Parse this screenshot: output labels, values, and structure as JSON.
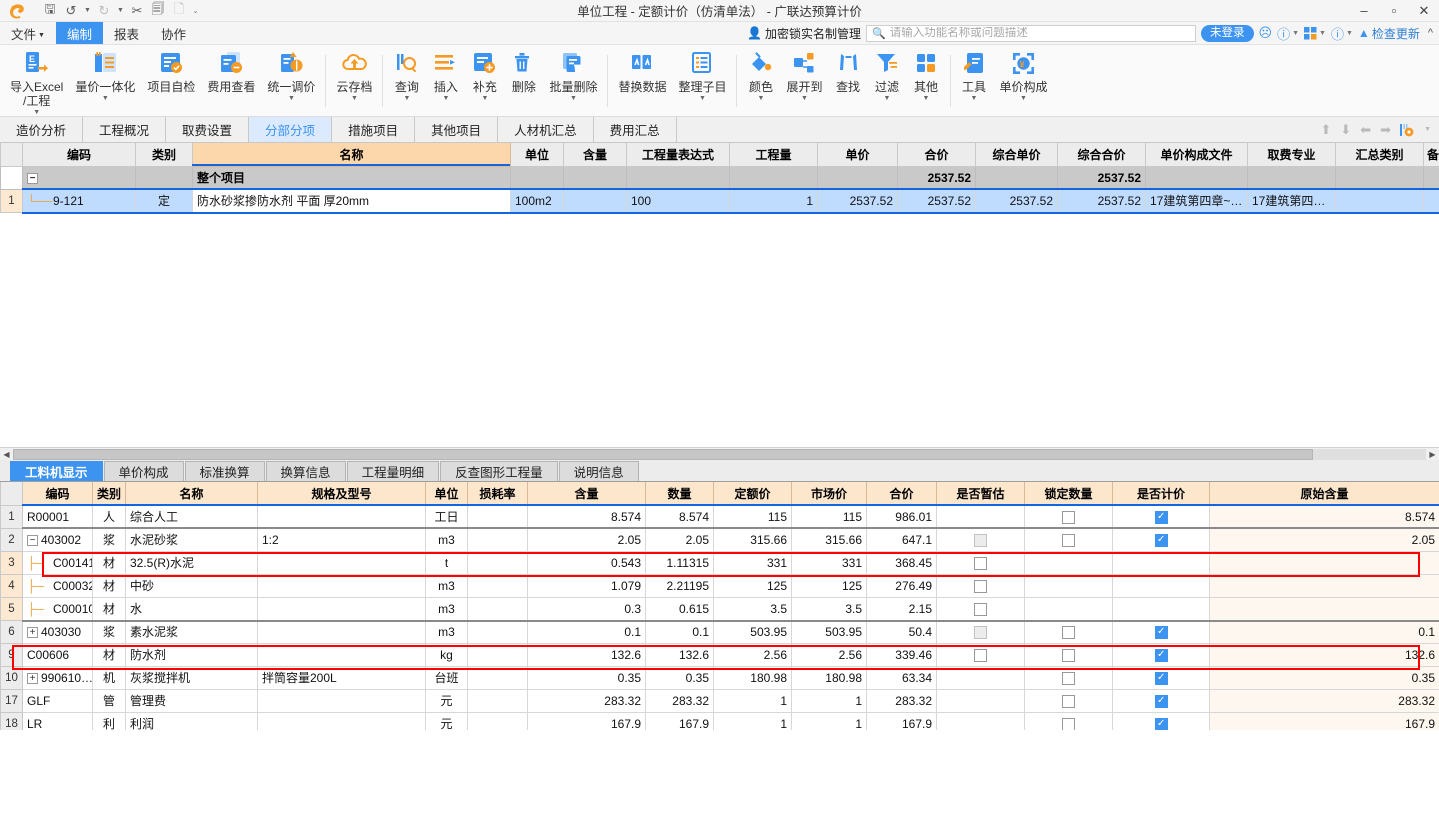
{
  "window": {
    "title": "单位工程 - 定额计价（仿清单法） - 广联达预算计价",
    "minimize": "–",
    "maximize": "▫",
    "close": "✕"
  },
  "quick_access": [
    {
      "name": "save-icon",
      "glyph": "🖫"
    },
    {
      "name": "undo-icon",
      "glyph": "↺"
    },
    {
      "name": "redo-icon",
      "glyph": "↻"
    },
    {
      "name": "cut-icon",
      "glyph": "✂"
    },
    {
      "name": "copy-icon",
      "glyph": "🗐"
    },
    {
      "name": "paste-icon",
      "glyph": "🗋"
    }
  ],
  "menu": {
    "items": [
      {
        "label": "文件",
        "caret": true,
        "active": false
      },
      {
        "label": "编制",
        "caret": false,
        "active": true
      },
      {
        "label": "报表",
        "caret": false,
        "active": false
      },
      {
        "label": "协作",
        "caret": false,
        "active": false
      }
    ],
    "lock_manager": "加密锁实名制管理",
    "login_status": "未登录",
    "check_update": "检查更新"
  },
  "search": {
    "placeholder": "请输入功能名称或问题描述",
    "value": ""
  },
  "ribbon": {
    "buttons": [
      {
        "label": "导入Excel\n/工程",
        "icon": "excel-import-icon",
        "caret": true
      },
      {
        "label": "量价一体化",
        "icon": "quantity-price-icon",
        "caret": true
      },
      {
        "label": "项目自检",
        "icon": "self-check-icon",
        "caret": false
      },
      {
        "label": "费用查看",
        "icon": "fee-view-icon",
        "caret": false
      },
      {
        "label": "统一调价",
        "icon": "unified-price-icon",
        "caret": true
      },
      {
        "label": "云存档",
        "icon": "cloud-archive-icon",
        "caret": true
      },
      {
        "label": "查询",
        "icon": "query-icon",
        "caret": true
      },
      {
        "label": "插入",
        "icon": "insert-icon",
        "caret": true
      },
      {
        "label": "补充",
        "icon": "supplement-icon",
        "caret": true
      },
      {
        "label": "删除",
        "icon": "delete-icon",
        "caret": false
      },
      {
        "label": "批量删除",
        "icon": "batch-delete-icon",
        "caret": true
      },
      {
        "label": "替换数据",
        "icon": "replace-data-icon",
        "caret": false
      },
      {
        "label": "整理子目",
        "icon": "organize-item-icon",
        "caret": true
      },
      {
        "label": "颜色",
        "icon": "color-icon",
        "caret": true
      },
      {
        "label": "展开到",
        "icon": "expand-to-icon",
        "caret": true
      },
      {
        "label": "查找",
        "icon": "find-icon",
        "caret": false
      },
      {
        "label": "过滤",
        "icon": "filter-icon",
        "caret": true
      },
      {
        "label": "其他",
        "icon": "other-icon",
        "caret": true
      },
      {
        "label": "工具",
        "icon": "tools-icon",
        "caret": true
      },
      {
        "label": "单价构成",
        "icon": "unit-price-composition-icon",
        "caret": true
      }
    ]
  },
  "tabs": {
    "items": [
      {
        "label": "造价分析",
        "active": false
      },
      {
        "label": "工程概况",
        "active": false
      },
      {
        "label": "取费设置",
        "active": false
      },
      {
        "label": "分部分项",
        "active": true
      },
      {
        "label": "措施项目",
        "active": false
      },
      {
        "label": "其他项目",
        "active": false
      },
      {
        "label": "人材机汇总",
        "active": false
      },
      {
        "label": "费用汇总",
        "active": false
      }
    ],
    "nav_icons": [
      "arrow-up-icon",
      "arrow-down-icon",
      "arrow-left-icon",
      "arrow-right-icon",
      "column-settings-icon"
    ]
  },
  "main_table": {
    "columns": [
      "",
      "编码",
      "类别",
      "名称",
      "单位",
      "含量",
      "工程量表达式",
      "工程量",
      "单价",
      "合价",
      "综合单价",
      "综合合价",
      "单价构成文件",
      "取费专业",
      "汇总类别",
      "备"
    ],
    "rows": [
      {
        "type": "group",
        "row_number": "",
        "expander": "−",
        "cells": {
          "编码": "",
          "类别": "",
          "名称": "整个项目",
          "单位": "",
          "含量": "",
          "工程量表达式": "",
          "工程量": "",
          "单价": "",
          "合价": "2537.52",
          "综合单价": "",
          "综合合价": "2537.52",
          "单价构成文件": "",
          "取费专业": "",
          "汇总类别": "",
          "备": ""
        }
      },
      {
        "type": "data",
        "row_number": "1",
        "selected": true,
        "cells": {
          "编码": "9-121",
          "类别": "定",
          "名称": "防水砂浆掺防水剂 平面  厚20mm",
          "单位": "100m2",
          "含量": "",
          "工程量表达式": "100",
          "工程量": "1",
          "单价": "2537.52",
          "合价": "2537.52",
          "综合单价": "2537.52",
          "综合合价": "2537.52",
          "单价构成文件": "17建筑第四章~…",
          "取费专业": "17建筑第四…",
          "汇总类别": "",
          "备": ""
        }
      }
    ]
  },
  "bottom_tabs": {
    "items": [
      {
        "label": "工料机显示",
        "active": true
      },
      {
        "label": "单价构成",
        "active": false
      },
      {
        "label": "标准换算",
        "active": false
      },
      {
        "label": "换算信息",
        "active": false
      },
      {
        "label": "工程量明细",
        "active": false
      },
      {
        "label": "反查图形工程量",
        "active": false
      },
      {
        "label": "说明信息",
        "active": false
      }
    ]
  },
  "detail_table": {
    "columns": [
      "",
      "编码",
      "类别",
      "名称",
      "规格及型号",
      "单位",
      "损耗率",
      "含量",
      "数量",
      "定额价",
      "市场价",
      "合价",
      "是否暂估",
      "锁定数量",
      "是否计价",
      "原始含量"
    ],
    "rows": [
      {
        "row_number": "1",
        "indent": 0,
        "expander": "",
        "编码": "R00001",
        "类别": "人",
        "名称": "综合人工",
        "规格及型号": "",
        "单位": "工日",
        "损耗率": "",
        "含量": "8.574",
        "数量": "8.574",
        "定额价": "115",
        "市场价": "115",
        "合价": "986.01",
        "是否暂估": "none",
        "锁定数量": "off",
        "是否计价": "on",
        "原始含量": "8.574",
        "highlight": false
      },
      {
        "row_number": "2",
        "indent": 0,
        "expander": "−",
        "编码": "403002",
        "类别": "浆",
        "名称": "水泥砂浆",
        "规格及型号": "1:2",
        "单位": "m3",
        "损耗率": "",
        "含量": "2.05",
        "数量": "2.05",
        "定额价": "315.66",
        "市场价": "315.66",
        "合价": "647.1",
        "是否暂估": "dis",
        "锁定数量": "off",
        "是否计价": "on",
        "原始含量": "2.05",
        "highlight": false
      },
      {
        "row_number": "3",
        "indent": 1,
        "expander": "",
        "编码": "C00141",
        "类别": "材",
        "名称": "32.5(R)水泥",
        "规格及型号": "",
        "单位": "t",
        "损耗率": "",
        "含量": "0.543",
        "数量": "1.11315",
        "定额价": "331",
        "市场价": "331",
        "合价": "368.45",
        "是否暂估": "off",
        "锁定数量": "none",
        "是否计价": "none",
        "原始含量": "",
        "highlight": true
      },
      {
        "row_number": "4",
        "indent": 1,
        "expander": "",
        "编码": "C00032",
        "类别": "材",
        "名称": "中砂",
        "规格及型号": "",
        "单位": "m3",
        "损耗率": "",
        "含量": "1.079",
        "数量": "2.21195",
        "定额价": "125",
        "市场价": "125",
        "合价": "276.49",
        "是否暂估": "off",
        "锁定数量": "none",
        "是否计价": "none",
        "原始含量": "",
        "highlight": false
      },
      {
        "row_number": "5",
        "indent": 1,
        "expander": "",
        "编码": "C00010",
        "类别": "材",
        "名称": "水",
        "规格及型号": "",
        "单位": "m3",
        "损耗率": "",
        "含量": "0.3",
        "数量": "0.615",
        "定额价": "3.5",
        "市场价": "3.5",
        "合价": "2.15",
        "是否暂估": "off",
        "锁定数量": "none",
        "是否计价": "none",
        "原始含量": "",
        "highlight": false
      },
      {
        "row_number": "6",
        "indent": 0,
        "expander": "+",
        "编码": "403030",
        "类别": "浆",
        "名称": "素水泥浆",
        "规格及型号": "",
        "单位": "m3",
        "损耗率": "",
        "含量": "0.1",
        "数量": "0.1",
        "定额价": "503.95",
        "市场价": "503.95",
        "合价": "50.4",
        "是否暂估": "dis",
        "锁定数量": "off",
        "是否计价": "on",
        "原始含量": "0.1",
        "highlight": false
      },
      {
        "row_number": "9",
        "indent": 0,
        "expander": "",
        "编码": "C00606",
        "类别": "材",
        "名称": "防水剂",
        "规格及型号": "",
        "单位": "kg",
        "损耗率": "",
        "含量": "132.6",
        "数量": "132.6",
        "定额价": "2.56",
        "市场价": "2.56",
        "合价": "339.46",
        "是否暂估": "off",
        "锁定数量": "off",
        "是否计价": "on",
        "原始含量": "132.6",
        "highlight": true
      },
      {
        "row_number": "10",
        "indent": 0,
        "expander": "+",
        "编码": "990610…",
        "类别": "机",
        "名称": "灰浆搅拌机",
        "规格及型号": "拌筒容量200L",
        "单位": "台班",
        "损耗率": "",
        "含量": "0.35",
        "数量": "0.35",
        "定额价": "180.98",
        "市场价": "180.98",
        "合价": "63.34",
        "是否暂估": "none",
        "锁定数量": "off",
        "是否计价": "on",
        "原始含量": "0.35",
        "highlight": false
      },
      {
        "row_number": "17",
        "indent": 0,
        "expander": "",
        "编码": "GLF",
        "类别": "管",
        "名称": "管理费",
        "规格及型号": "",
        "单位": "元",
        "损耗率": "",
        "含量": "283.32",
        "数量": "283.32",
        "定额价": "1",
        "市场价": "1",
        "合价": "283.32",
        "是否暂估": "none",
        "锁定数量": "off",
        "是否计价": "on",
        "原始含量": "283.32",
        "highlight": false
      },
      {
        "row_number": "18",
        "indent": 0,
        "expander": "",
        "编码": "LR",
        "类别": "利",
        "名称": "利润",
        "规格及型号": "",
        "单位": "元",
        "损耗率": "",
        "含量": "167.9",
        "数量": "167.9",
        "定额价": "1",
        "市场价": "1",
        "合价": "167.9",
        "是否暂估": "none",
        "锁定数量": "off",
        "是否计价": "on",
        "原始含量": "167.9",
        "highlight": false
      }
    ]
  },
  "colors": {
    "accent": "#3c93f0",
    "selection": "#bfdcff",
    "header": "#fce6cc",
    "highlight": "#ff0000"
  }
}
